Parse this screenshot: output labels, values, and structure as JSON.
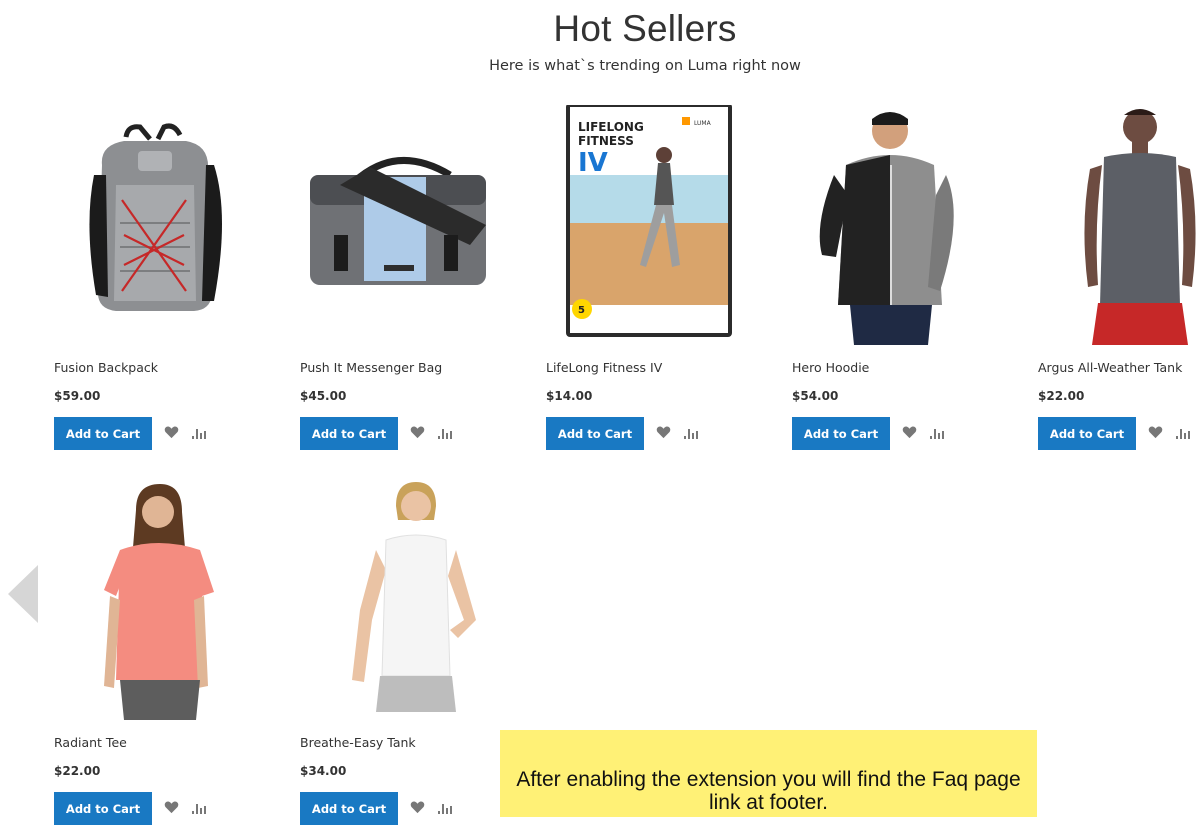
{
  "section": {
    "title": "Hot Sellers",
    "subtitle": "Here is what`s trending on Luma right now"
  },
  "products": [
    {
      "name": "Fusion Backpack",
      "price": "$59.00",
      "add_to_cart": "Add to Cart"
    },
    {
      "name": "Push It Messenger Bag",
      "price": "$45.00",
      "add_to_cart": "Add to Cart"
    },
    {
      "name": "LifeLong Fitness IV",
      "price": "$14.00",
      "add_to_cart": "Add to Cart"
    },
    {
      "name": "Hero Hoodie",
      "price": "$54.00",
      "add_to_cart": "Add to Cart"
    },
    {
      "name": "Argus All-Weather Tank",
      "price": "$22.00",
      "add_to_cart": "Add to Cart"
    },
    {
      "name": "Radiant Tee",
      "price": "$22.00",
      "add_to_cart": "Add to Cart"
    },
    {
      "name": "Breathe-Easy Tank",
      "price": "$34.00",
      "add_to_cart": "Add to Cart"
    }
  ],
  "dvd_cover": {
    "brand": "LUMA",
    "line1": "LIFELONG",
    "line2": "FITNESS",
    "numeral": "IV",
    "badge": "5"
  },
  "icons": {
    "wishlist": "heart-icon",
    "compare": "compare-bars-icon",
    "previous": "chevron-left-icon"
  },
  "notice": {
    "text": "After enabling the extension you will find the Faq page link at footer."
  },
  "colors": {
    "button": "#1979c3",
    "notice_bg": "#fff176",
    "icon": "#777777"
  }
}
